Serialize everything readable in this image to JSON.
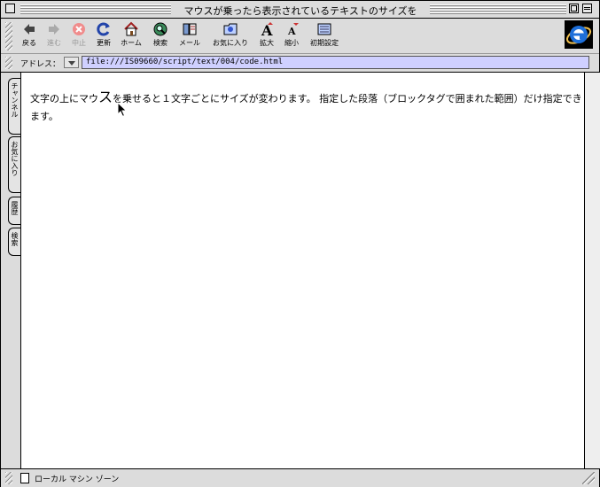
{
  "window": {
    "title": "マウスが乗ったら表示されているテキストのサイズを"
  },
  "toolbar": {
    "buttons": [
      {
        "label": "戻る",
        "icon": "back-arrow-icon"
      },
      {
        "label": "進む",
        "icon": "forward-arrow-icon"
      },
      {
        "label": "中止",
        "icon": "stop-icon"
      },
      {
        "label": "更新",
        "icon": "refresh-icon"
      },
      {
        "label": "ホーム",
        "icon": "home-icon"
      },
      {
        "label": "検索",
        "icon": "search-icon"
      },
      {
        "label": "メール",
        "icon": "mail-icon"
      },
      {
        "label": "お気に入り",
        "icon": "favorites-icon"
      },
      {
        "label": "拡大",
        "icon": "text-larger-icon"
      },
      {
        "label": "縮小",
        "icon": "text-smaller-icon"
      },
      {
        "label": "初期設定",
        "icon": "preferences-icon"
      }
    ]
  },
  "address": {
    "label": "アドレス：",
    "url": "file:///IS09660/script/text/004/code.html"
  },
  "sidetabs": [
    "チャンネル",
    "お気に入り",
    "履歴",
    "検索"
  ],
  "content": {
    "text_before": "文字の上にマウ",
    "text_big": "ス",
    "text_after": "を乗せると１文字ごとにサイズが変わります。 指定した段落（ブロックタグで囲まれた範囲）だけ指定できます。"
  },
  "status": {
    "text": "ローカル マシン ゾーン"
  },
  "colors": {
    "address_bg": "#cfd0ff",
    "stop_icon": "#e23a3a",
    "ie_logo": "#1e6fd9"
  }
}
